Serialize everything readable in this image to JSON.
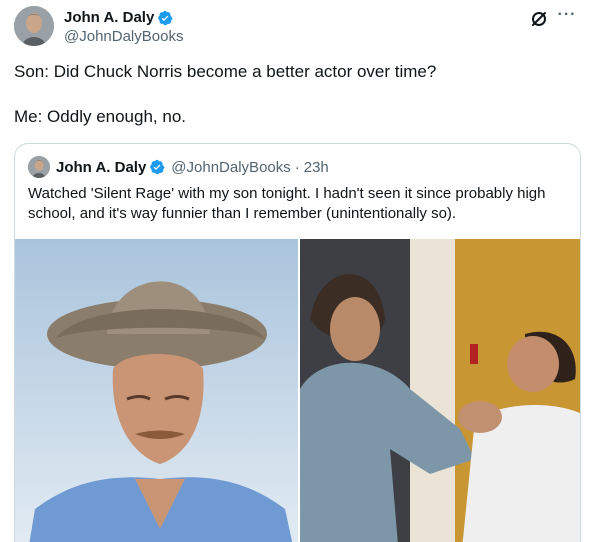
{
  "tweet": {
    "display_name": "John A. Daly",
    "handle": "@JohnDalyBooks",
    "lines": [
      "Son: Did Chuck Norris become a better actor over time?",
      "Me: Oddly enough, no."
    ]
  },
  "quote": {
    "display_name": "John A. Daly",
    "handle": "@JohnDalyBooks",
    "dot": "·",
    "time": "23h",
    "text": "Watched 'Silent Rage' with my son tonight. I hadn't seen it since probably high school, and it's way funnier than I remember (unintentionally so)."
  },
  "icons": {
    "verified": "verified-badge-icon",
    "grok": "grok-icon",
    "more": "more-icon"
  },
  "colors": {
    "verified_blue": "#1d9bf0",
    "text_primary": "#0f1419",
    "text_secondary": "#536471",
    "border": "#cfd9de"
  }
}
